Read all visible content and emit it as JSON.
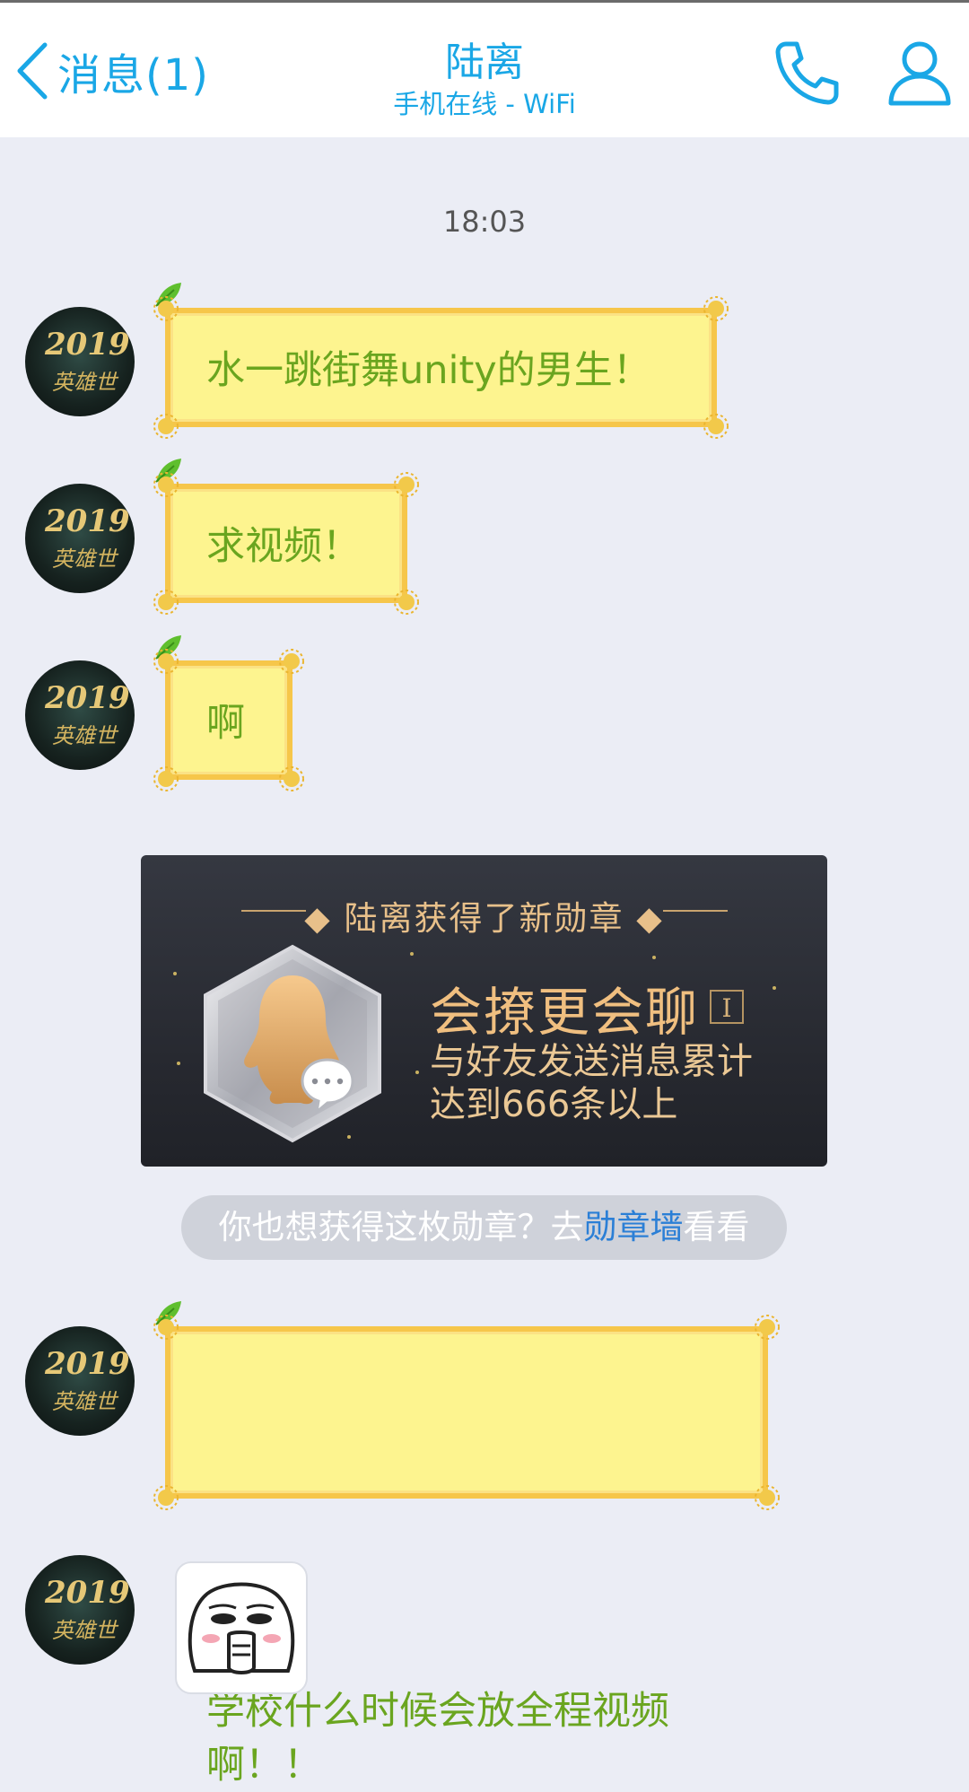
{
  "header": {
    "back_label": "消息(1)",
    "contact_name": "陆离",
    "contact_status": "手机在线 - WiFi"
  },
  "conversation": {
    "timestamp": "18:03",
    "messages": [
      {
        "text": "水一跳街舞unity的男生！"
      },
      {
        "text": "求视频！"
      },
      {
        "text": "啊"
      },
      {
        "text": "学校什么时候会放全程视频\n啊！！"
      }
    ],
    "avatar": {
      "year": "2019",
      "subtitle": "英雄世"
    }
  },
  "badge_card": {
    "headline": "陆离获得了新勋章",
    "badge_name": "会撩更会聊",
    "badge_level": "I",
    "badge_description": "与好友发送消息累计\n达到666条以上"
  },
  "badge_prompt": {
    "prefix": "你也想获得这枚勋章？去",
    "link": "勋章墙",
    "suffix": "看看"
  },
  "icons": {
    "back": "chevron-left-icon",
    "phone": "phone-icon",
    "profile": "person-icon",
    "badge": "qq-penguin-badge-icon",
    "sticker": "meme-sticker-icon"
  },
  "colors": {
    "accent": "#1aa7e6",
    "bubble_fill": "#fdf48f",
    "bubble_border": "#f6c64a",
    "bubble_text": "#6aa51f",
    "badge_gold": "#f0bf80",
    "chat_background": "#ebedf5",
    "link": "#2b7fd6"
  }
}
